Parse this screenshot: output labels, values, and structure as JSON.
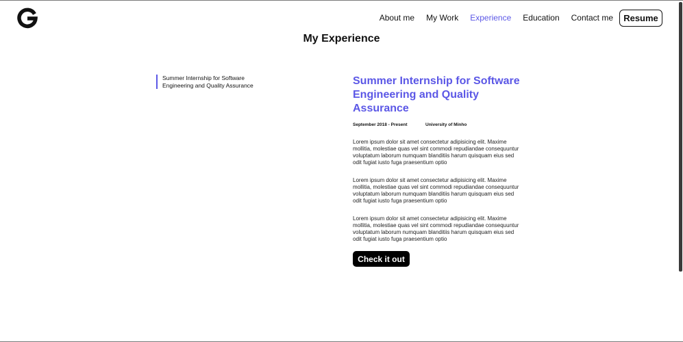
{
  "logo": {
    "letter": "G"
  },
  "nav": {
    "links": [
      "About me",
      "My Work",
      "Experience",
      "Education",
      "Contact me"
    ],
    "active": "Experience",
    "resume_label": "Resume"
  },
  "page": {
    "title": "My Experience"
  },
  "experience_list": [
    {
      "label": "Summer Internship for Software Engineering and Quality Assurance"
    }
  ],
  "detail": {
    "title": "Summer Internship for Software Engineering and Quality Assurance",
    "dates": "September 2018 - Present",
    "organization": "University of Minho",
    "paragraphs": [
      "Lorem ipsum dolor sit amet consectetur adipisicing elit. Maxime mollitia, molestiae quas vel sint commodi repudiandae consequuntur voluptatum laborum numquam blanditiis harum quisquam eius sed odit fugiat iusto fuga praesentium optio",
      "Lorem ipsum dolor sit amet consectetur adipisicing elit. Maxime mollitia, molestiae quas vel sint commodi repudiandae consequuntur voluptatum laborum numquam blanditiis harum quisquam eius sed odit fugiat iusto fuga praesentium optio",
      "Lorem ipsum dolor sit amet consectetur adipisicing elit. Maxime mollitia, molestiae quas vel sint commodi repudiandae consequuntur voluptatum laborum numquam blanditiis harum quisquam eius sed odit fugiat iusto fuga praesentium optio"
    ],
    "cta_label": "Check it out"
  },
  "colors": {
    "accent": "#5b57e6",
    "text": "#111111",
    "button_bg": "#000000"
  }
}
